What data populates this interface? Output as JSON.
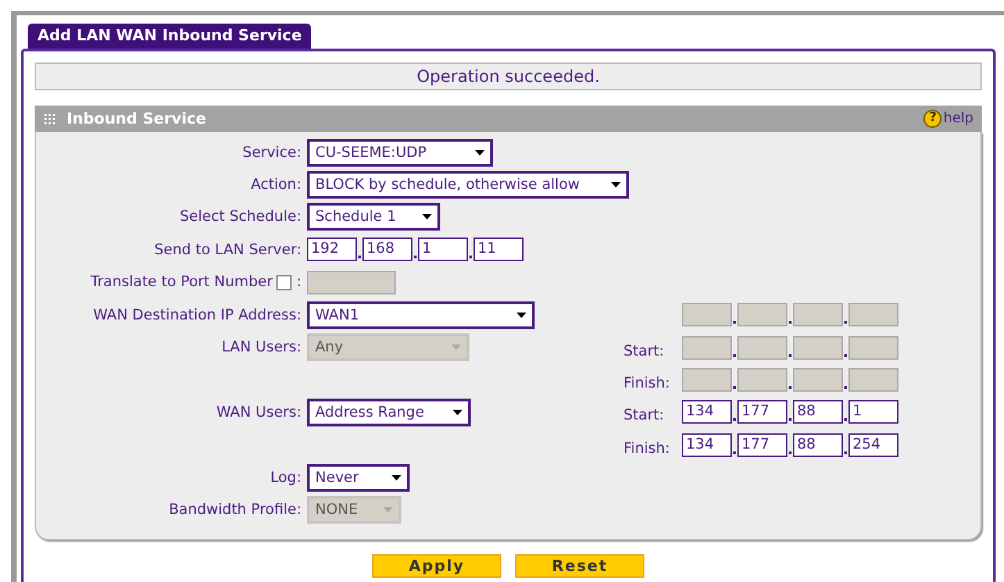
{
  "tab": {
    "label": "Add LAN WAN Inbound Service",
    "selected": true
  },
  "message": "Operation succeeded.",
  "section": {
    "title": "Inbound Service",
    "help_icon": "?",
    "help_label": "help"
  },
  "rows": [
    {
      "label": "Service:",
      "control": {
        "kind": "select",
        "value": "CU-SEEME:UDP",
        "disabled": false
      }
    },
    {
      "label": "Action:",
      "control": {
        "kind": "select",
        "value": "BLOCK by schedule, otherwise allow",
        "disabled": false
      }
    },
    {
      "label": "Select Schedule:",
      "control": {
        "kind": "select",
        "value": "Schedule 1",
        "disabled": false
      }
    },
    {
      "label": "Send to LAN Server:",
      "control": {
        "kind": "ip",
        "octets": [
          "192",
          "168",
          "1",
          "11"
        ],
        "disabled": false
      }
    },
    {
      "label": "Translate to Port Number",
      "checkbox": {
        "checked": false
      },
      "colon": ":",
      "control": {
        "kind": "text",
        "disabled": true
      }
    },
    {
      "label": "WAN Destination IP Address:",
      "control": {
        "kind": "select",
        "value": "WAN1",
        "disabled": false
      },
      "right": {
        "disabled": true
      }
    },
    {
      "label": "LAN Users:",
      "control": {
        "kind": "select",
        "value": "Any",
        "disabled": true
      },
      "right": {
        "label": "Start:",
        "disabled": true
      }
    },
    {
      "right": {
        "label": "Finish:",
        "disabled": true
      }
    },
    {
      "label": "WAN Users:",
      "control": {
        "kind": "select",
        "value": "Address Range",
        "disabled": false
      },
      "right": {
        "label": "Start:",
        "octets": [
          "134",
          "177",
          "88",
          "1"
        ],
        "disabled": false
      }
    },
    {
      "right": {
        "label": "Finish:",
        "octets": [
          "134",
          "177",
          "88",
          "254"
        ],
        "disabled": false
      }
    },
    {
      "label": "Log:",
      "control": {
        "kind": "select",
        "value": "Never",
        "disabled": false
      }
    },
    {
      "label": "Bandwidth Profile:",
      "control": {
        "kind": "select",
        "value": "NONE",
        "disabled": true
      }
    }
  ],
  "buttons": [
    "Apply",
    "Reset"
  ]
}
